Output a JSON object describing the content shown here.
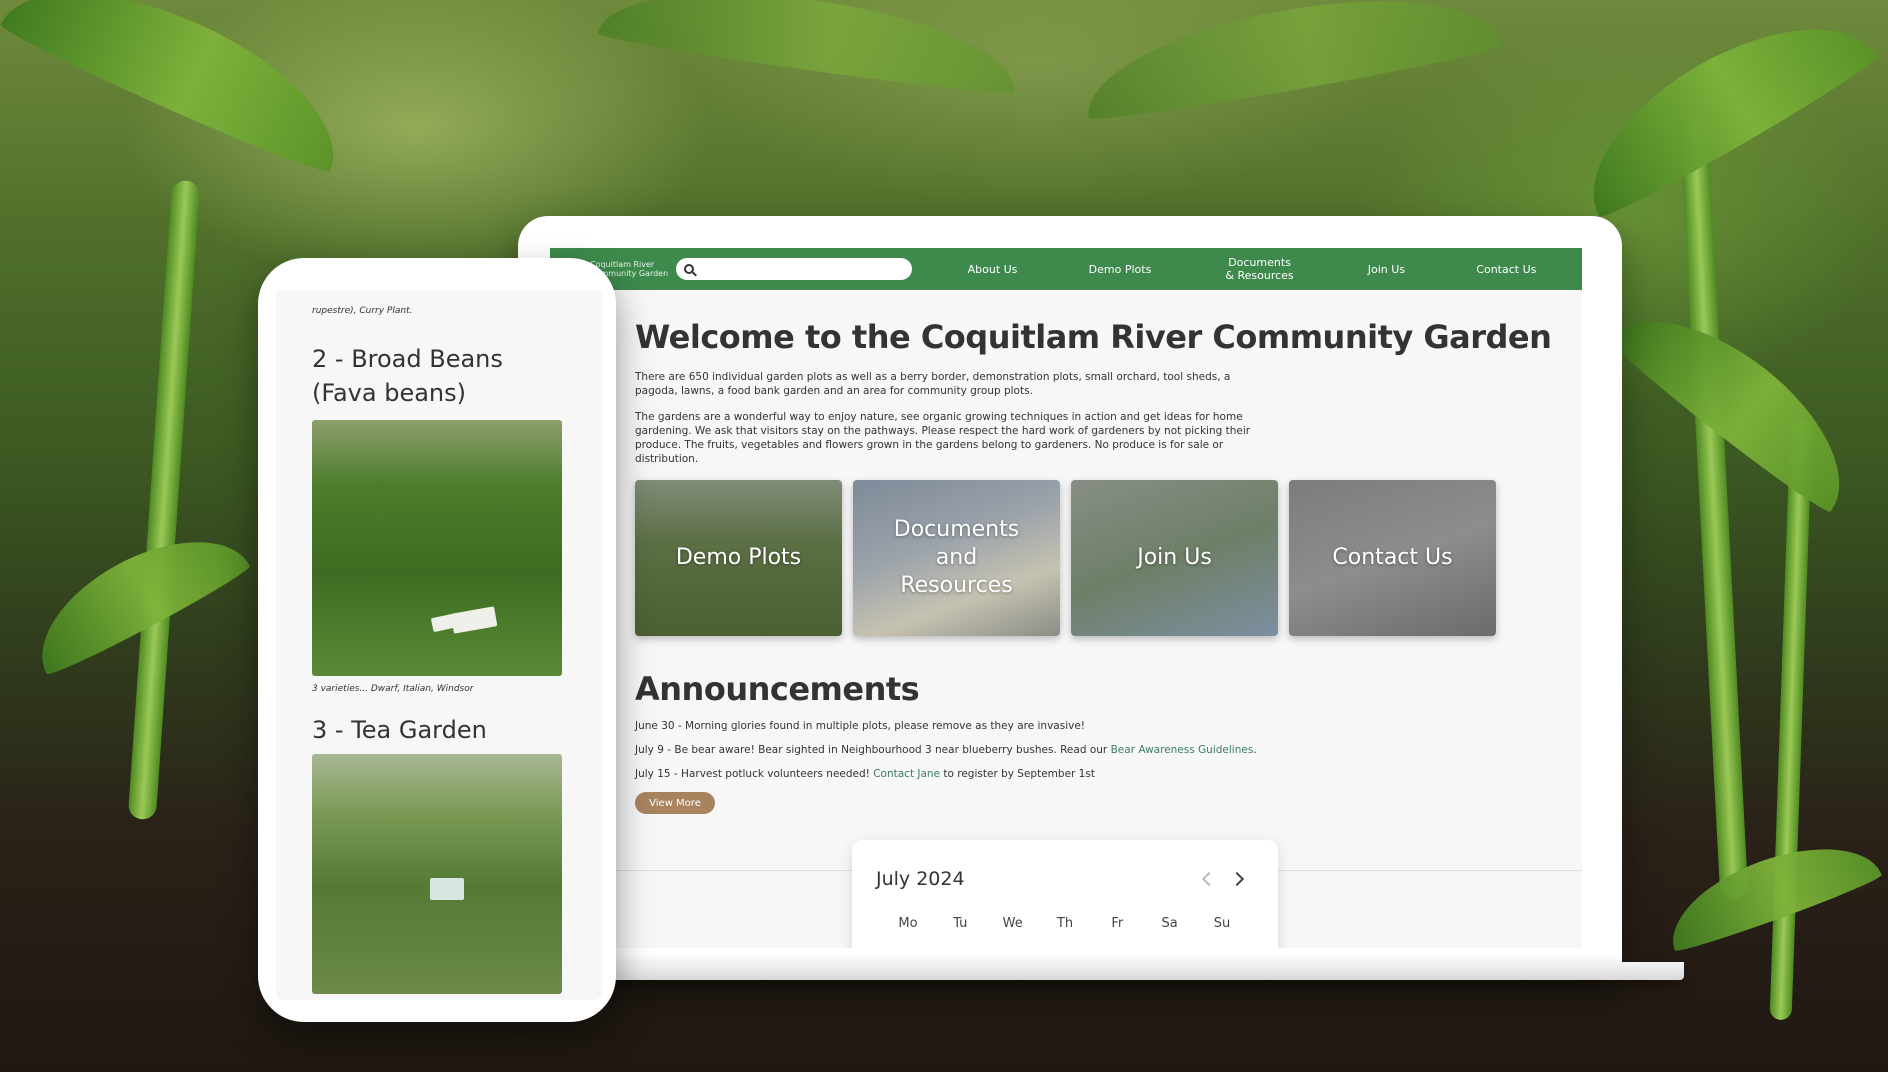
{
  "site": {
    "logo_text_line1": "Coquitlam River",
    "logo_text_line2": "Community Garden",
    "search_placeholder": "",
    "nav": [
      {
        "label": "About Us"
      },
      {
        "label": "Demo Plots"
      },
      {
        "label": "Documents & Resources"
      },
      {
        "label": "Join Us"
      },
      {
        "label": "Contact Us"
      }
    ]
  },
  "main": {
    "title": "Welcome to the Coquitlam River Community Garden",
    "intro1": "There are 650 individual garden plots as well as a berry border, demonstration plots, small orchard, tool sheds, a pagoda, lawns, a food bank garden and an area for community group plots.",
    "intro2": "The gardens are a wonderful way to enjoy nature, see organic growing techniques in action and get ideas for home gardening. We ask that visitors stay on the pathways. Please respect the hard work of gardeners by not picking their produce. The fruits, vegetables and flowers grown in the gardens belong to gardeners. No produce is for sale or distribution.",
    "cards": [
      {
        "label": "Demo Plots"
      },
      {
        "label": "Documents and Resources"
      },
      {
        "label": "Join Us"
      },
      {
        "label": "Contact Us"
      }
    ],
    "announcements_title": "Announcements",
    "announcements": [
      {
        "text": "June 30 - Morning glories found in multiple plots, please remove as they are invasive!",
        "link": "",
        "after": ""
      },
      {
        "text": "July 9 - Be bear aware! Bear sighted in Neighbourhood 3 near blueberry bushes. Read our ",
        "link": "Bear Awareness Guidelines",
        "after": "."
      },
      {
        "text": "July 15 - Harvest potluck volunteers needed! ",
        "link": "Contact Jane",
        "after": " to register by September 1st"
      }
    ],
    "view_more": "View More"
  },
  "calendar": {
    "month": "July 2024",
    "days": [
      "Mo",
      "Tu",
      "We",
      "Th",
      "Fr",
      "Sa",
      "Su"
    ]
  },
  "phone": {
    "top_text": "rupestre), Curry Plant.",
    "item1_title": "2 - Broad Beans (Fava beans)",
    "item1_caption": "3 varieties... Dwarf, Italian, Windsor",
    "item2_title": "3 - Tea Garden"
  },
  "colors": {
    "nav_green": "#3d8a4c",
    "button_brown": "#a8845e",
    "link_teal": "#3d7a66"
  }
}
